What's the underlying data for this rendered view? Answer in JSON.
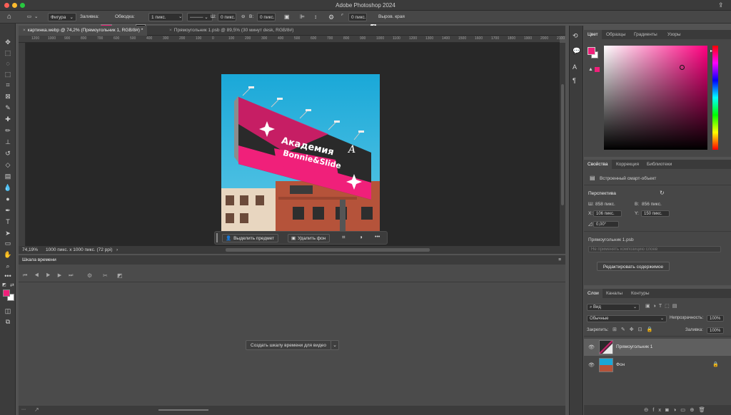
{
  "window": {
    "title": "Adobe Photoshop 2024"
  },
  "options": {
    "shape_mode": "Фигура",
    "fill_label": "Заливка:",
    "stroke_label": "Обводка:",
    "stroke_width": "1 пикс.",
    "w_label": "Ш:",
    "w_value": "0 пикс.",
    "h_label": "В:",
    "h_value": "0 пикс.",
    "radius_value": "0 пикс.",
    "align_edges": "Выров. края",
    "fill_color": "#f0207a"
  },
  "tabs": [
    {
      "label": "картинка.webp @ 74,2% (Прямоугольник 1, RGB/8#) *"
    },
    {
      "label": "Прямоугольник 1.psb @ 89,5% (30 минут desk, RGB/8#)"
    }
  ],
  "ruler": {
    "ticks": [
      "1200",
      "1000",
      "900",
      "800",
      "700",
      "600",
      "500",
      "400",
      "300",
      "200",
      "100",
      "0",
      "100",
      "200",
      "300",
      "400",
      "500",
      "600",
      "700",
      "800",
      "900",
      "1000",
      "1100",
      "1200",
      "1300",
      "1400",
      "1500",
      "1600",
      "1700",
      "1800",
      "1900",
      "2000",
      "2100"
    ]
  },
  "image": {
    "line1": "Академия",
    "line2": "Bonnie&Slide",
    "brand_accent": "#f0207a",
    "sky": "#1e9bd2"
  },
  "context_bar": {
    "select_subject": "Выделить предмет",
    "remove_bg": "Удалить фон",
    "more": "•••"
  },
  "status": {
    "zoom": "74,19%",
    "doc": "1000 пикс. x 1000 пикс. (72 ppi)"
  },
  "timeline": {
    "title": "Шкала времени",
    "create_button": "Создать шкалу времени для видео"
  },
  "color_panel": {
    "tabs": [
      "Цвет",
      "Образцы",
      "Градиенты",
      "Узоры"
    ],
    "hue_color": "#ff0080"
  },
  "properties": {
    "tabs": [
      "Свойства",
      "Коррекция",
      "Библиотеки"
    ],
    "object_type": "Встроенный смарт-объект",
    "section": "Перспектива",
    "w_label": "Ш:",
    "w_value": "858 пикс.",
    "h_label": "В:",
    "h_value": "856 пикс.",
    "x_label": "X:",
    "x_value": "106 пикс.",
    "y_label": "Y:",
    "y_value": "150 пикс.",
    "angle_value": "0,00°",
    "file": "Прямоугольник 1.psb",
    "comp_placeholder": "Не применять композицию слоев",
    "edit_button": "Редактировать содержимое"
  },
  "layers_panel": {
    "tabs": [
      "Слои",
      "Каналы",
      "Контуры"
    ],
    "filter": "Вид",
    "blend": "Обычные",
    "opacity_label": "Непрозрачность:",
    "opacity": "100%",
    "lock_label": "Закрепить:",
    "fill_label": "Заливка:",
    "fill": "100%",
    "layers": [
      {
        "name": "Прямоугольник 1"
      },
      {
        "name": "Фон"
      }
    ]
  }
}
